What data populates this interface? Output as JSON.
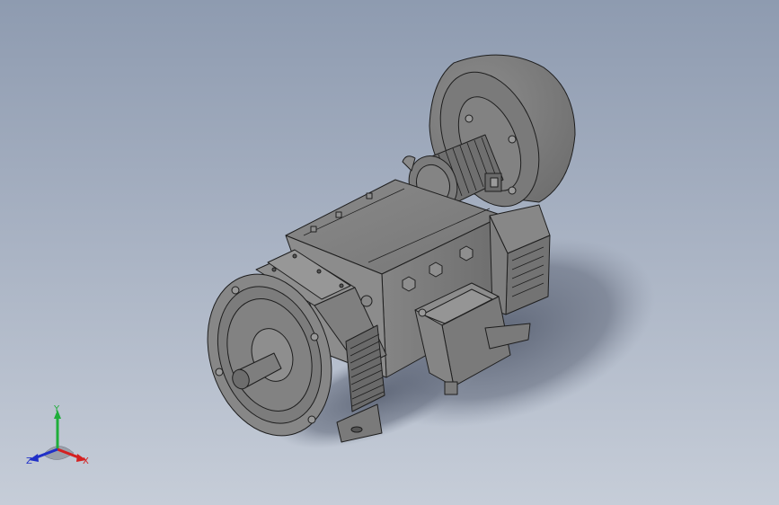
{
  "viewport": {
    "background_top": "#8e9bb0",
    "background_bottom": "#c6cdd8",
    "model_color": "#7d7d7d",
    "edge_color": "#1e1e1e",
    "shadow_color": "#6f7788"
  },
  "model": {
    "icon": "dc-motor-icon"
  },
  "triad": {
    "x_label": "X",
    "y_label": "Y",
    "z_label": "Z",
    "x_color": "#d42020",
    "y_color": "#1fae3a",
    "z_color": "#2030c8"
  }
}
